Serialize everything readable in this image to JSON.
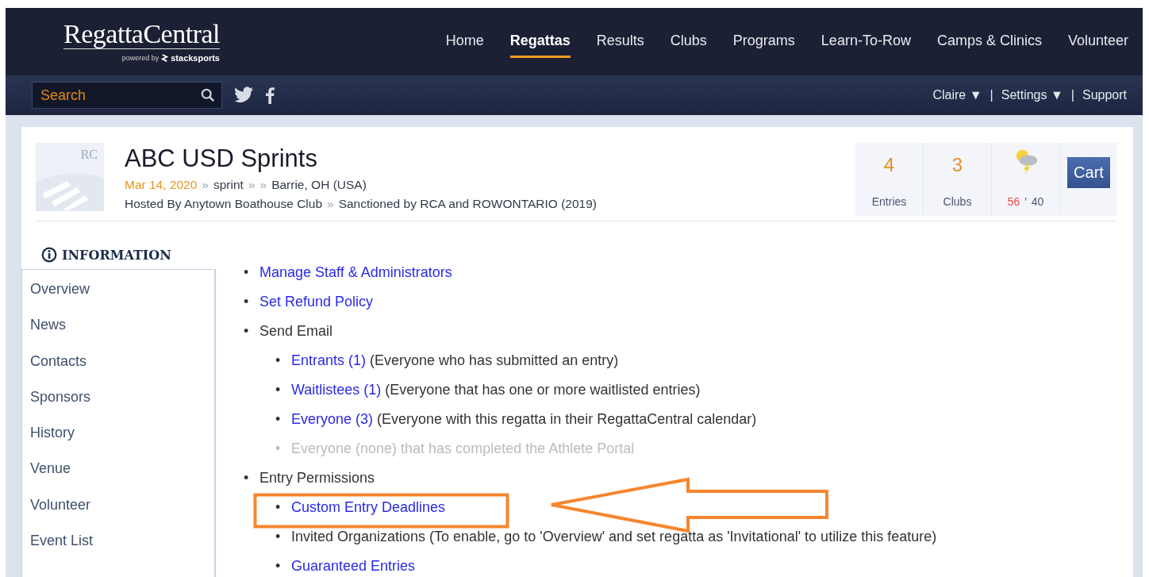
{
  "header": {
    "logo": "RegattaCentral",
    "powered_by": "powered by",
    "powered_brand": "stacksports",
    "nav": [
      {
        "label": "Home",
        "selected": false
      },
      {
        "label": "Regattas",
        "selected": true
      },
      {
        "label": "Results",
        "selected": false
      },
      {
        "label": "Clubs",
        "selected": false
      },
      {
        "label": "Programs",
        "selected": false
      },
      {
        "label": "Learn-To-Row",
        "selected": false
      },
      {
        "label": "Camps & Clinics",
        "selected": false
      },
      {
        "label": "Volunteer",
        "selected": false
      }
    ]
  },
  "subbar": {
    "search": {
      "placeholder": "Search"
    },
    "user_menu": [
      "Claire ▼",
      "Settings ▼",
      "Support"
    ],
    "separator": "|"
  },
  "regatta": {
    "logo_text": "RC",
    "title": "ABC USD Sprints",
    "date": "Mar 14, 2020",
    "type": "sprint",
    "location": "Barrie, OH (USA)",
    "arrow": "»",
    "host": "Hosted By Anytown Boathouse Club",
    "sanction": "Sanctioned by RCA and ROWONTARIO (2019)",
    "stats": [
      {
        "value": "4",
        "label": "Entries"
      },
      {
        "value": "3",
        "label": "Clubs"
      }
    ],
    "weather": {
      "high": "56",
      "mark": "′",
      "low": "40"
    },
    "cart": "Cart"
  },
  "sidebar": {
    "heading": "INFORMATION",
    "items": [
      "Overview",
      "News",
      "Contacts",
      "Sponsors",
      "History",
      "Venue",
      "Volunteer",
      "Event List"
    ]
  },
  "actions": [
    {
      "marker": "•",
      "kind": "link",
      "text": "Manage Staff & Administrators"
    },
    {
      "marker": "•",
      "kind": "link",
      "text": "Set Refund Policy"
    },
    {
      "marker": "•",
      "kind": "text",
      "text": "Send Email",
      "children": [
        {
          "marker": "•",
          "kind": "link",
          "text": "Entrants (1)",
          "note": "(Everyone who has submitted an entry)",
          "disabled": false,
          "highlighted": false
        },
        {
          "marker": "•",
          "kind": "link",
          "text": "Waitlistees (1)",
          "note": "(Everyone that has one or more waitlisted entries)",
          "disabled": false,
          "highlighted": false
        },
        {
          "marker": "•",
          "kind": "link",
          "text": "Everyone (3)",
          "note": "(Everyone with this regatta in their RegattaCentral calendar)",
          "disabled": false,
          "highlighted": false
        },
        {
          "marker": "•",
          "kind": "text",
          "text": "Everyone (none) that has completed the Athlete Portal",
          "disabled": true,
          "highlighted": false
        }
      ]
    },
    {
      "marker": "•",
      "kind": "text",
      "text": "Entry Permissions",
      "children": [
        {
          "marker": "•",
          "kind": "link",
          "text": "Custom Entry Deadlines",
          "disabled": false,
          "highlighted": true
        },
        {
          "marker": "•",
          "kind": "text",
          "text": "Invited Organizations (To enable, go to 'Overview' and set regatta as 'Invitational' to utilize this feature)",
          "disabled": false,
          "highlighted": false
        },
        {
          "marker": "•",
          "kind": "link",
          "text": "Guaranteed Entries",
          "disabled": false,
          "highlighted": false
        }
      ]
    }
  ]
}
